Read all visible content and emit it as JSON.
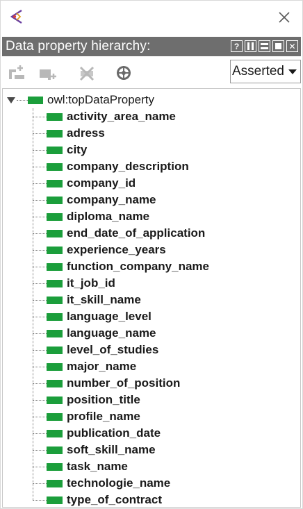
{
  "window": {
    "app_icon": "protege-logo-icon",
    "close_icon": "close-icon"
  },
  "view": {
    "title": "Data property hierarchy:",
    "buttons": [
      {
        "name": "help-icon",
        "glyph": "?"
      },
      {
        "name": "split-icon",
        "glyph": ""
      },
      {
        "name": "minimize-icon",
        "glyph": ""
      },
      {
        "name": "maximize-icon",
        "glyph": ""
      },
      {
        "name": "close-view-icon",
        "glyph": "✕"
      }
    ]
  },
  "toolbar": {
    "tools": [
      {
        "name": "add-sub-property-icon"
      },
      {
        "name": "add-sibling-property-icon"
      },
      {
        "name": "delete-property-icon"
      },
      {
        "name": "find-usage-icon"
      }
    ],
    "mode_select": {
      "value": "Asserted",
      "options": [
        "Asserted"
      ]
    }
  },
  "colors": {
    "header_bg": "#6e6e6e",
    "property_green": "#1b9e3b"
  },
  "tree": {
    "root": {
      "label": "owl:topDataProperty",
      "expanded": true
    },
    "children": [
      "activity_area_name",
      "adress",
      "city",
      "company_description",
      "company_id",
      "company_name",
      "diploma_name",
      "end_date_of_application",
      "experience_years",
      "function_company_name",
      "it_job_id",
      "it_skill_name",
      "language_level",
      "language_name",
      "level_of_studies",
      "major_name",
      "number_of_position",
      "position_title",
      "profile_name",
      "publication_date",
      "soft_skill_name",
      "task_name",
      "technologie_name",
      "type_of_contract"
    ]
  }
}
